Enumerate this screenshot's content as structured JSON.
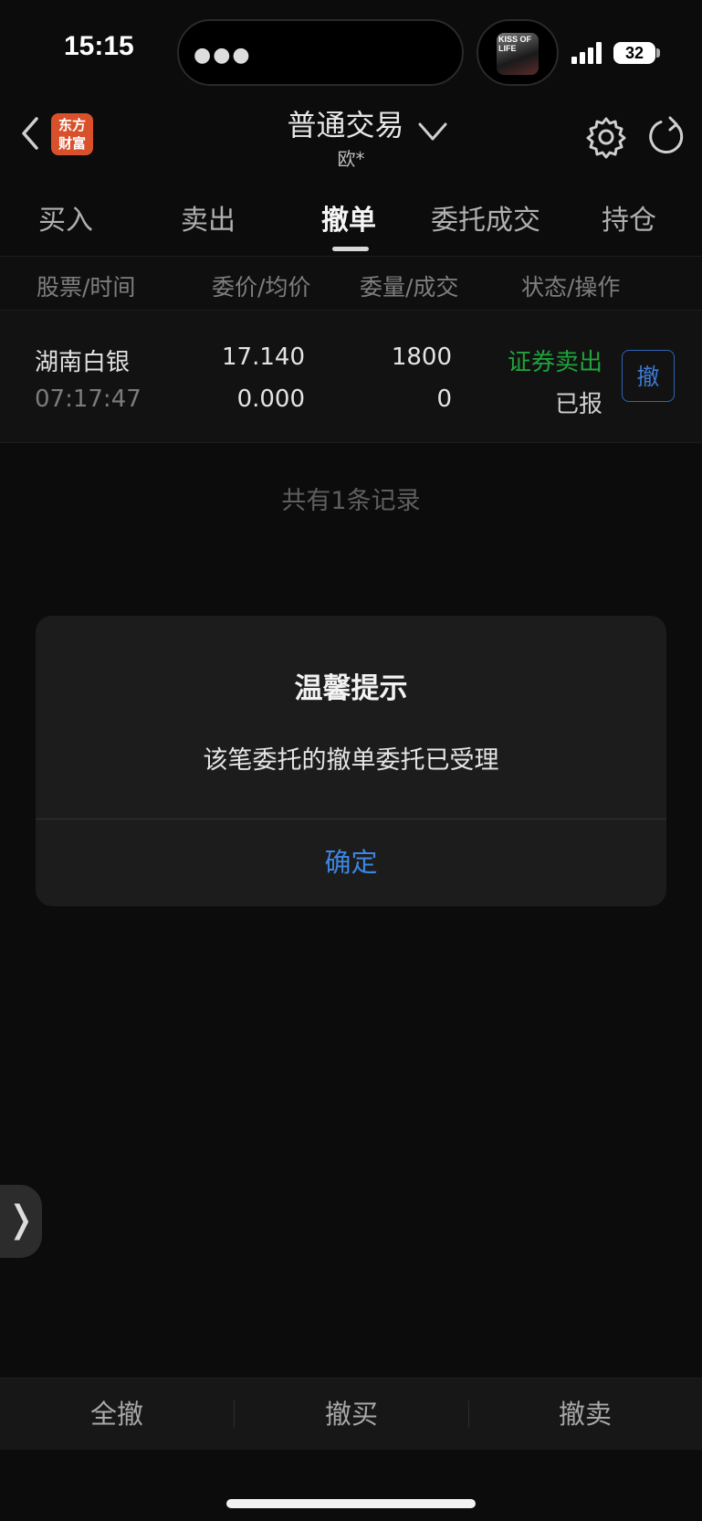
{
  "status_bar": {
    "time": "15:15",
    "battery": "32",
    "now_playing_art_text": "KISS OF LIFE"
  },
  "header": {
    "title": "普通交易",
    "subtitle": "欧*",
    "logo_line1": "东方",
    "logo_line2": "财富"
  },
  "tabs": [
    {
      "label": "买入",
      "active": false
    },
    {
      "label": "卖出",
      "active": false
    },
    {
      "label": "撤单",
      "active": true
    },
    {
      "label": "委托成交",
      "active": false
    },
    {
      "label": "持仓",
      "active": false
    }
  ],
  "columns": [
    "股票/时间",
    "委价/均价",
    "委量/成交",
    "状态/操作"
  ],
  "orders": [
    {
      "stock": "湖南白银",
      "time": "07:17:47",
      "price": "17.140",
      "avg_price": "0.000",
      "quantity": "1800",
      "filled": "0",
      "direction": "证券卖出",
      "status": "已报",
      "action": "撤"
    }
  ],
  "records_text": "共有1条记录",
  "dialog": {
    "title": "温馨提示",
    "message": "该笔委托的撤单委托已受理",
    "confirm": "确定"
  },
  "bottom_bar": {
    "cancel_all": "全撤",
    "cancel_buy": "撤买",
    "cancel_sell": "撤卖"
  },
  "colors": {
    "sell_green": "#1fa33c",
    "accent_blue": "#3d85e0",
    "logo_orange": "#d8512b"
  }
}
